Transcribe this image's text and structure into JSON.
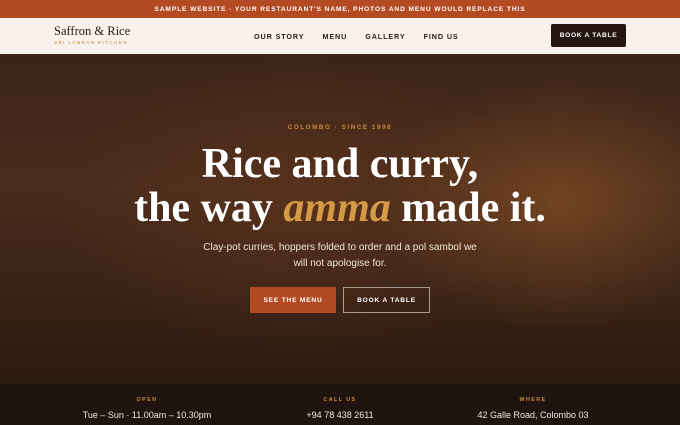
{
  "banner": {
    "text": "SAMPLE WEBSITE · YOUR RESTAURANT'S NAME, PHOTOS AND MENU WOULD REPLACE THIS"
  },
  "brand": {
    "name": "Saffron & Rice",
    "tagline": "SRI LANKAN KITCHEN"
  },
  "nav": {
    "items": [
      {
        "label": "OUR STORY"
      },
      {
        "label": "MENU"
      },
      {
        "label": "GALLERY"
      },
      {
        "label": "FIND US"
      }
    ],
    "cta_label": "BOOK A TABLE"
  },
  "hero": {
    "eyebrow": "COLOMBO · SINCE 1998",
    "headline_line1": "Rice and curry,",
    "headline_line2_before": "the way ",
    "headline_line2_accent": "amma",
    "headline_line2_after": " made it.",
    "subtext": "Clay-pot curries, hoppers folded to order and a pol sambol we will not apologise for.",
    "primary_button": "SEE THE MENU",
    "secondary_button": "BOOK A TABLE"
  },
  "info": [
    {
      "label": "OPEN",
      "value": "Tue – Sun · 11.00am – 10.30pm"
    },
    {
      "label": "CALL US",
      "value": "+94 78 438 2611"
    },
    {
      "label": "WHERE",
      "value": "42 Galle Road, Colombo 03"
    }
  ],
  "colors": {
    "accent": "#b44a22",
    "gold": "#c98b3a",
    "dark": "#23150f",
    "cream": "#f8f2ea"
  }
}
